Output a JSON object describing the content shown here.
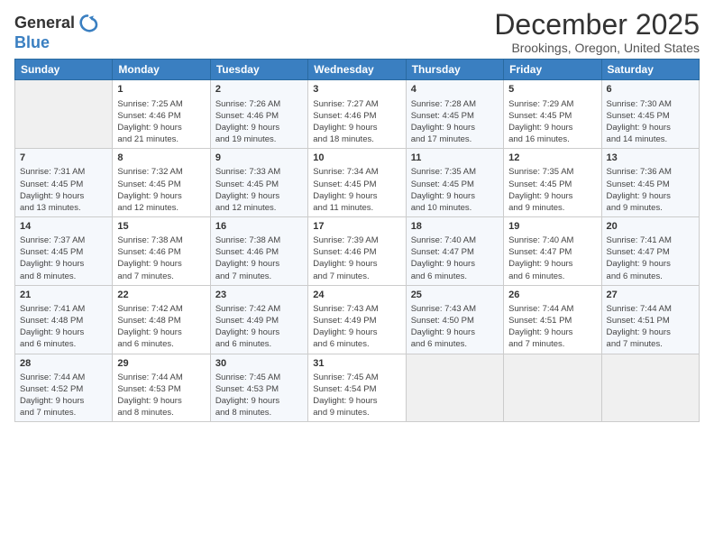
{
  "header": {
    "logo_general": "General",
    "logo_blue": "Blue",
    "title": "December 2025",
    "location": "Brookings, Oregon, United States"
  },
  "weekdays": [
    "Sunday",
    "Monday",
    "Tuesday",
    "Wednesday",
    "Thursday",
    "Friday",
    "Saturday"
  ],
  "weeks": [
    [
      {
        "day": "",
        "info": ""
      },
      {
        "day": "1",
        "info": "Sunrise: 7:25 AM\nSunset: 4:46 PM\nDaylight: 9 hours\nand 21 minutes."
      },
      {
        "day": "2",
        "info": "Sunrise: 7:26 AM\nSunset: 4:46 PM\nDaylight: 9 hours\nand 19 minutes."
      },
      {
        "day": "3",
        "info": "Sunrise: 7:27 AM\nSunset: 4:46 PM\nDaylight: 9 hours\nand 18 minutes."
      },
      {
        "day": "4",
        "info": "Sunrise: 7:28 AM\nSunset: 4:45 PM\nDaylight: 9 hours\nand 17 minutes."
      },
      {
        "day": "5",
        "info": "Sunrise: 7:29 AM\nSunset: 4:45 PM\nDaylight: 9 hours\nand 16 minutes."
      },
      {
        "day": "6",
        "info": "Sunrise: 7:30 AM\nSunset: 4:45 PM\nDaylight: 9 hours\nand 14 minutes."
      }
    ],
    [
      {
        "day": "7",
        "info": "Sunrise: 7:31 AM\nSunset: 4:45 PM\nDaylight: 9 hours\nand 13 minutes."
      },
      {
        "day": "8",
        "info": "Sunrise: 7:32 AM\nSunset: 4:45 PM\nDaylight: 9 hours\nand 12 minutes."
      },
      {
        "day": "9",
        "info": "Sunrise: 7:33 AM\nSunset: 4:45 PM\nDaylight: 9 hours\nand 12 minutes."
      },
      {
        "day": "10",
        "info": "Sunrise: 7:34 AM\nSunset: 4:45 PM\nDaylight: 9 hours\nand 11 minutes."
      },
      {
        "day": "11",
        "info": "Sunrise: 7:35 AM\nSunset: 4:45 PM\nDaylight: 9 hours\nand 10 minutes."
      },
      {
        "day": "12",
        "info": "Sunrise: 7:35 AM\nSunset: 4:45 PM\nDaylight: 9 hours\nand 9 minutes."
      },
      {
        "day": "13",
        "info": "Sunrise: 7:36 AM\nSunset: 4:45 PM\nDaylight: 9 hours\nand 9 minutes."
      }
    ],
    [
      {
        "day": "14",
        "info": "Sunrise: 7:37 AM\nSunset: 4:45 PM\nDaylight: 9 hours\nand 8 minutes."
      },
      {
        "day": "15",
        "info": "Sunrise: 7:38 AM\nSunset: 4:46 PM\nDaylight: 9 hours\nand 7 minutes."
      },
      {
        "day": "16",
        "info": "Sunrise: 7:38 AM\nSunset: 4:46 PM\nDaylight: 9 hours\nand 7 minutes."
      },
      {
        "day": "17",
        "info": "Sunrise: 7:39 AM\nSunset: 4:46 PM\nDaylight: 9 hours\nand 7 minutes."
      },
      {
        "day": "18",
        "info": "Sunrise: 7:40 AM\nSunset: 4:47 PM\nDaylight: 9 hours\nand 6 minutes."
      },
      {
        "day": "19",
        "info": "Sunrise: 7:40 AM\nSunset: 4:47 PM\nDaylight: 9 hours\nand 6 minutes."
      },
      {
        "day": "20",
        "info": "Sunrise: 7:41 AM\nSunset: 4:47 PM\nDaylight: 9 hours\nand 6 minutes."
      }
    ],
    [
      {
        "day": "21",
        "info": "Sunrise: 7:41 AM\nSunset: 4:48 PM\nDaylight: 9 hours\nand 6 minutes."
      },
      {
        "day": "22",
        "info": "Sunrise: 7:42 AM\nSunset: 4:48 PM\nDaylight: 9 hours\nand 6 minutes."
      },
      {
        "day": "23",
        "info": "Sunrise: 7:42 AM\nSunset: 4:49 PM\nDaylight: 9 hours\nand 6 minutes."
      },
      {
        "day": "24",
        "info": "Sunrise: 7:43 AM\nSunset: 4:49 PM\nDaylight: 9 hours\nand 6 minutes."
      },
      {
        "day": "25",
        "info": "Sunrise: 7:43 AM\nSunset: 4:50 PM\nDaylight: 9 hours\nand 6 minutes."
      },
      {
        "day": "26",
        "info": "Sunrise: 7:44 AM\nSunset: 4:51 PM\nDaylight: 9 hours\nand 7 minutes."
      },
      {
        "day": "27",
        "info": "Sunrise: 7:44 AM\nSunset: 4:51 PM\nDaylight: 9 hours\nand 7 minutes."
      }
    ],
    [
      {
        "day": "28",
        "info": "Sunrise: 7:44 AM\nSunset: 4:52 PM\nDaylight: 9 hours\nand 7 minutes."
      },
      {
        "day": "29",
        "info": "Sunrise: 7:44 AM\nSunset: 4:53 PM\nDaylight: 9 hours\nand 8 minutes."
      },
      {
        "day": "30",
        "info": "Sunrise: 7:45 AM\nSunset: 4:53 PM\nDaylight: 9 hours\nand 8 minutes."
      },
      {
        "day": "31",
        "info": "Sunrise: 7:45 AM\nSunset: 4:54 PM\nDaylight: 9 hours\nand 9 minutes."
      },
      {
        "day": "",
        "info": ""
      },
      {
        "day": "",
        "info": ""
      },
      {
        "day": "",
        "info": ""
      }
    ]
  ]
}
